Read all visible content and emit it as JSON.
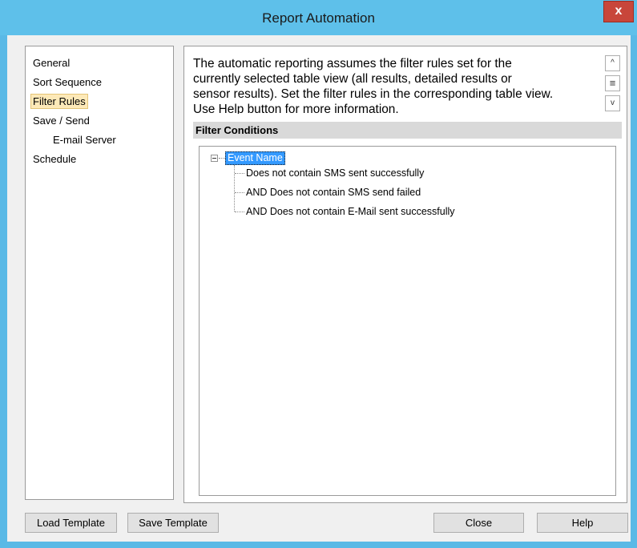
{
  "window": {
    "title": "Report Automation",
    "close_label": "x"
  },
  "nav": {
    "items": [
      {
        "label": "General"
      },
      {
        "label": "Sort Sequence"
      },
      {
        "label": "Filter Rules",
        "selected": true
      },
      {
        "label": "Save / Send"
      },
      {
        "label": "E-mail Server",
        "indent": true
      },
      {
        "label": "Schedule"
      }
    ]
  },
  "content": {
    "description_lines": [
      "The automatic reporting assumes the filter rules set for the",
      "currently selected table view (all results, detailed results or",
      "sensor results). Set the filter rules in the corresponding table view.",
      "Use Help button for more information."
    ],
    "scroll_up_icon": "^",
    "scroll_thumb_icon": "≡",
    "scroll_down_icon": "v",
    "section_title": "Filter Conditions",
    "tree": {
      "root_label": "Event Name",
      "children": [
        "Does not contain SMS sent successfully",
        "AND Does not contain SMS send failed",
        "AND Does not contain E-Mail sent successfully"
      ]
    }
  },
  "footer": {
    "load_template": "Load Template",
    "save_template": "Save Template",
    "close": "Close",
    "help": "Help"
  }
}
